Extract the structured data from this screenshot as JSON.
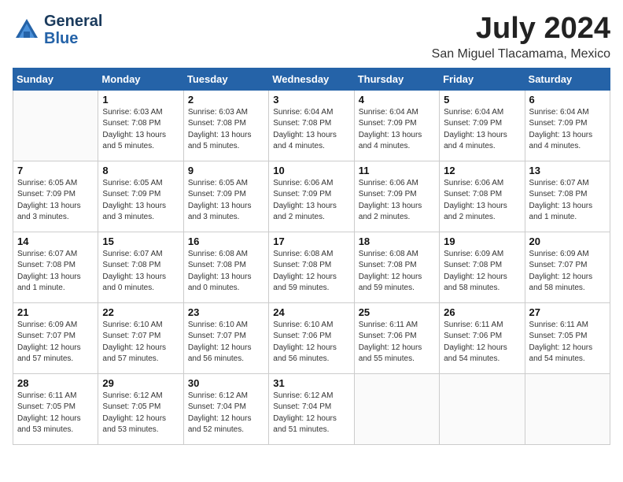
{
  "header": {
    "logo_line1": "General",
    "logo_line2": "Blue",
    "month_title": "July 2024",
    "location": "San Miguel Tlacamama, Mexico"
  },
  "weekdays": [
    "Sunday",
    "Monday",
    "Tuesday",
    "Wednesday",
    "Thursday",
    "Friday",
    "Saturday"
  ],
  "weeks": [
    [
      {
        "day": "",
        "info": ""
      },
      {
        "day": "1",
        "info": "Sunrise: 6:03 AM\nSunset: 7:08 PM\nDaylight: 13 hours\nand 5 minutes."
      },
      {
        "day": "2",
        "info": "Sunrise: 6:03 AM\nSunset: 7:08 PM\nDaylight: 13 hours\nand 5 minutes."
      },
      {
        "day": "3",
        "info": "Sunrise: 6:04 AM\nSunset: 7:08 PM\nDaylight: 13 hours\nand 4 minutes."
      },
      {
        "day": "4",
        "info": "Sunrise: 6:04 AM\nSunset: 7:09 PM\nDaylight: 13 hours\nand 4 minutes."
      },
      {
        "day": "5",
        "info": "Sunrise: 6:04 AM\nSunset: 7:09 PM\nDaylight: 13 hours\nand 4 minutes."
      },
      {
        "day": "6",
        "info": "Sunrise: 6:04 AM\nSunset: 7:09 PM\nDaylight: 13 hours\nand 4 minutes."
      }
    ],
    [
      {
        "day": "7",
        "info": "Sunrise: 6:05 AM\nSunset: 7:09 PM\nDaylight: 13 hours\nand 3 minutes."
      },
      {
        "day": "8",
        "info": "Sunrise: 6:05 AM\nSunset: 7:09 PM\nDaylight: 13 hours\nand 3 minutes."
      },
      {
        "day": "9",
        "info": "Sunrise: 6:05 AM\nSunset: 7:09 PM\nDaylight: 13 hours\nand 3 minutes."
      },
      {
        "day": "10",
        "info": "Sunrise: 6:06 AM\nSunset: 7:09 PM\nDaylight: 13 hours\nand 2 minutes."
      },
      {
        "day": "11",
        "info": "Sunrise: 6:06 AM\nSunset: 7:09 PM\nDaylight: 13 hours\nand 2 minutes."
      },
      {
        "day": "12",
        "info": "Sunrise: 6:06 AM\nSunset: 7:08 PM\nDaylight: 13 hours\nand 2 minutes."
      },
      {
        "day": "13",
        "info": "Sunrise: 6:07 AM\nSunset: 7:08 PM\nDaylight: 13 hours\nand 1 minute."
      }
    ],
    [
      {
        "day": "14",
        "info": "Sunrise: 6:07 AM\nSunset: 7:08 PM\nDaylight: 13 hours\nand 1 minute."
      },
      {
        "day": "15",
        "info": "Sunrise: 6:07 AM\nSunset: 7:08 PM\nDaylight: 13 hours\nand 0 minutes."
      },
      {
        "day": "16",
        "info": "Sunrise: 6:08 AM\nSunset: 7:08 PM\nDaylight: 13 hours\nand 0 minutes."
      },
      {
        "day": "17",
        "info": "Sunrise: 6:08 AM\nSunset: 7:08 PM\nDaylight: 12 hours\nand 59 minutes."
      },
      {
        "day": "18",
        "info": "Sunrise: 6:08 AM\nSunset: 7:08 PM\nDaylight: 12 hours\nand 59 minutes."
      },
      {
        "day": "19",
        "info": "Sunrise: 6:09 AM\nSunset: 7:08 PM\nDaylight: 12 hours\nand 58 minutes."
      },
      {
        "day": "20",
        "info": "Sunrise: 6:09 AM\nSunset: 7:07 PM\nDaylight: 12 hours\nand 58 minutes."
      }
    ],
    [
      {
        "day": "21",
        "info": "Sunrise: 6:09 AM\nSunset: 7:07 PM\nDaylight: 12 hours\nand 57 minutes."
      },
      {
        "day": "22",
        "info": "Sunrise: 6:10 AM\nSunset: 7:07 PM\nDaylight: 12 hours\nand 57 minutes."
      },
      {
        "day": "23",
        "info": "Sunrise: 6:10 AM\nSunset: 7:07 PM\nDaylight: 12 hours\nand 56 minutes."
      },
      {
        "day": "24",
        "info": "Sunrise: 6:10 AM\nSunset: 7:06 PM\nDaylight: 12 hours\nand 56 minutes."
      },
      {
        "day": "25",
        "info": "Sunrise: 6:11 AM\nSunset: 7:06 PM\nDaylight: 12 hours\nand 55 minutes."
      },
      {
        "day": "26",
        "info": "Sunrise: 6:11 AM\nSunset: 7:06 PM\nDaylight: 12 hours\nand 54 minutes."
      },
      {
        "day": "27",
        "info": "Sunrise: 6:11 AM\nSunset: 7:05 PM\nDaylight: 12 hours\nand 54 minutes."
      }
    ],
    [
      {
        "day": "28",
        "info": "Sunrise: 6:11 AM\nSunset: 7:05 PM\nDaylight: 12 hours\nand 53 minutes."
      },
      {
        "day": "29",
        "info": "Sunrise: 6:12 AM\nSunset: 7:05 PM\nDaylight: 12 hours\nand 53 minutes."
      },
      {
        "day": "30",
        "info": "Sunrise: 6:12 AM\nSunset: 7:04 PM\nDaylight: 12 hours\nand 52 minutes."
      },
      {
        "day": "31",
        "info": "Sunrise: 6:12 AM\nSunset: 7:04 PM\nDaylight: 12 hours\nand 51 minutes."
      },
      {
        "day": "",
        "info": ""
      },
      {
        "day": "",
        "info": ""
      },
      {
        "day": "",
        "info": ""
      }
    ]
  ]
}
